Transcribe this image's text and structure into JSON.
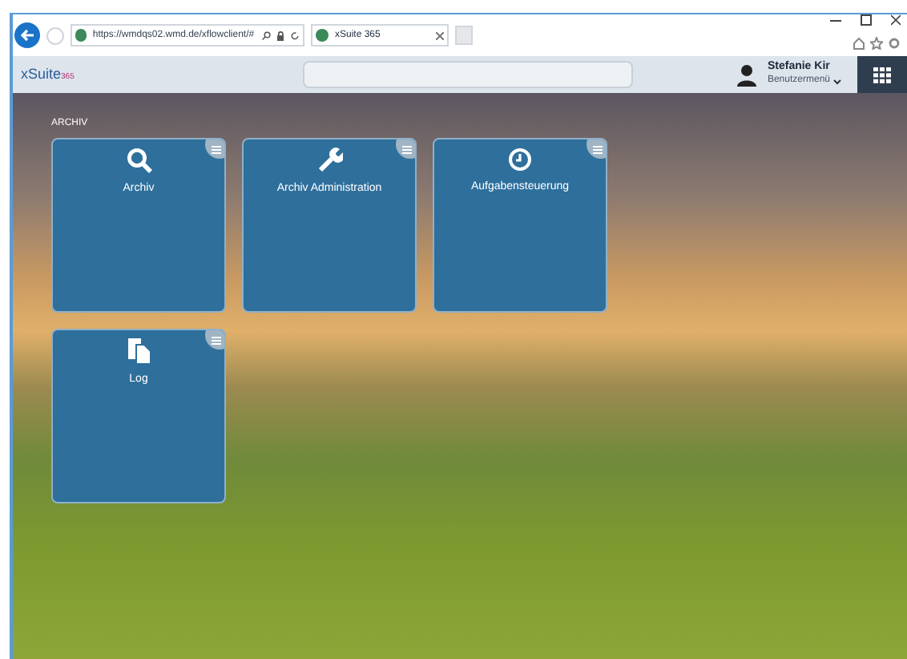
{
  "browser": {
    "url": "https://wmdqs02.wmd.de/xflowclient/#",
    "tabs": [
      {
        "title": "xSuite 365",
        "selected": true
      }
    ]
  },
  "header": {
    "logo": "xSuite",
    "logo_sub": "365",
    "user_name": "Stefanie Kir",
    "user_menu": "Benutzermenü"
  },
  "section": "ARCHIV",
  "tiles": [
    {
      "label": "Archiv",
      "kind": "search"
    },
    {
      "label": "Archiv Administration",
      "kind": "wrench"
    },
    {
      "label": "Aufgabensteuerung",
      "kind": "clock"
    },
    {
      "label": "Log",
      "kind": "document"
    }
  ]
}
